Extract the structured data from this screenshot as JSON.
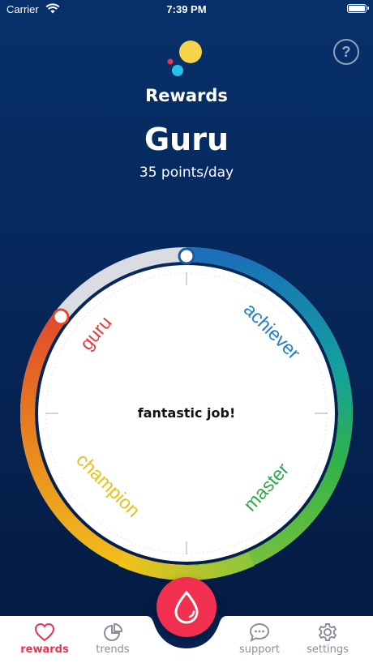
{
  "status_bar": {
    "carrier": "Carrier",
    "time": "7:39 PM"
  },
  "header": {
    "title": "Rewards",
    "help_label": "?"
  },
  "level": {
    "name": "Guru",
    "points": "35 points/day"
  },
  "dial": {
    "center_message": "fantastic job!",
    "labels": [
      "guru",
      "achiever",
      "master",
      "champion"
    ],
    "colors": {
      "guru": "#e83a3a",
      "achiever": "#1f7fc4",
      "master": "#2ea84a",
      "champion": "#e6c21a"
    }
  },
  "tabs": [
    {
      "label": "rewards",
      "icon": "heart-icon",
      "active": true
    },
    {
      "label": "trends",
      "icon": "pie-chart-icon",
      "active": false
    },
    {
      "label": "support",
      "icon": "chat-bubble-icon",
      "active": false
    },
    {
      "label": "settings",
      "icon": "gear-icon",
      "active": false
    }
  ],
  "colors": {
    "accent": "#f0304e",
    "background": "#07306a"
  }
}
